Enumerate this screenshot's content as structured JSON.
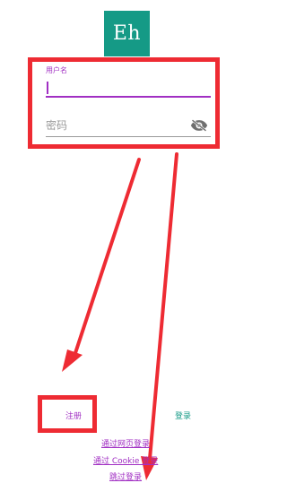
{
  "logo": {
    "text": "Eh"
  },
  "login_form": {
    "username_label": "用户名",
    "username_value": "",
    "password_placeholder": "密码",
    "password_value": "",
    "password_toggle_icon": "eye-off-icon"
  },
  "actions": {
    "register_label": "注册",
    "login_label": "登录"
  },
  "alt_login": {
    "web_label": "通过网页登录",
    "cookie_label": "通过 Cookie 登录",
    "skip_label": "跳过登录"
  },
  "colors": {
    "accent": "#a12fc3",
    "brand": "#159a86",
    "annotation": "#ee2b33"
  }
}
